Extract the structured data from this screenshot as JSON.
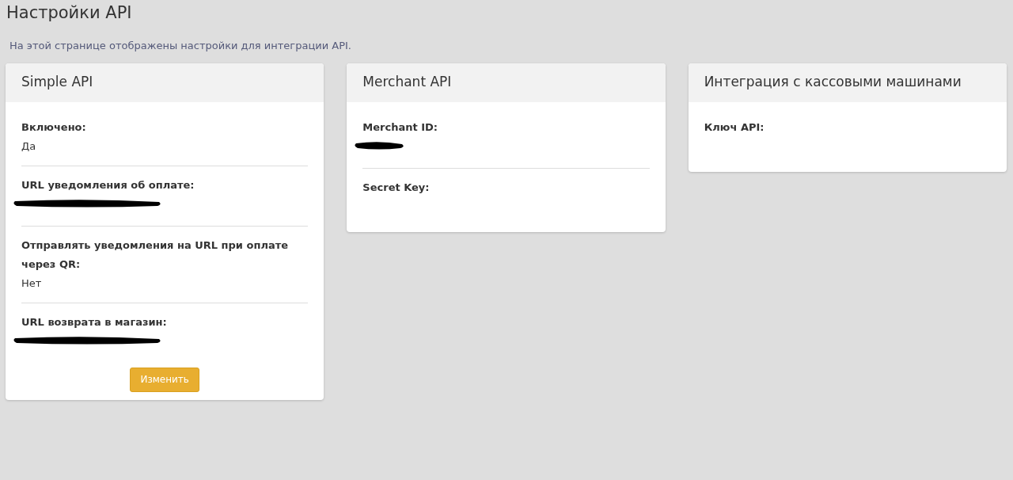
{
  "page": {
    "title": "Настройки API",
    "description": "На этой странице отображены настройки для интеграции API."
  },
  "cards": [
    {
      "title": "Simple API",
      "fields": [
        {
          "kind": "text",
          "label": "Включено:",
          "value": "Да"
        },
        {
          "kind": "redactedlong",
          "label": "URL уведомления об оплате:"
        },
        {
          "kind": "text",
          "label": "Отправлять уведомления на URL при оплате через QR:",
          "value": "Нет"
        },
        {
          "kind": "redactedlong",
          "label": "URL возврата в магазин:"
        }
      ],
      "button": "Изменить"
    },
    {
      "title": "Merchant API",
      "fields": [
        {
          "kind": "redactedshort",
          "label": "Merchant ID:"
        },
        {
          "kind": "empty",
          "label": "Secret Key:"
        }
      ]
    },
    {
      "title": "Интеграция с кассовыми машинами",
      "fields": [
        {
          "kind": "empty",
          "label": "Ключ API:"
        }
      ]
    }
  ]
}
